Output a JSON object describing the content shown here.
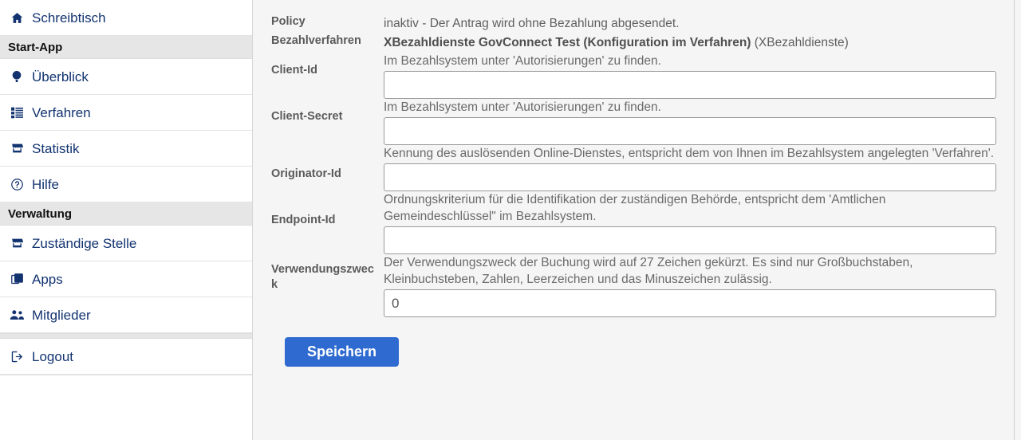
{
  "sidebar": {
    "top_items": [
      {
        "label": "Schreibtisch",
        "icon": "home-icon",
        "name": "schreibtisch"
      }
    ],
    "sections": [
      {
        "title": "Start-App",
        "items": [
          {
            "label": "Überblick",
            "icon": "balloon-icon",
            "name": "ueberblick"
          },
          {
            "label": "Verfahren",
            "icon": "list-icon",
            "name": "verfahren"
          },
          {
            "label": "Statistik",
            "icon": "storefront-icon",
            "name": "statistik"
          },
          {
            "label": "Hilfe",
            "icon": "help-circle-icon",
            "name": "hilfe"
          }
        ]
      },
      {
        "title": "Verwaltung",
        "items": [
          {
            "label": "Zuständige Stelle",
            "icon": "storefront-icon",
            "name": "zustaendige-stelle"
          },
          {
            "label": "Apps",
            "icon": "layers-icon",
            "name": "apps"
          },
          {
            "label": "Mitglieder",
            "icon": "people-icon",
            "name": "mitglieder"
          }
        ]
      }
    ],
    "footer_items": [
      {
        "label": "Logout",
        "icon": "logout-icon",
        "name": "logout"
      }
    ]
  },
  "form": {
    "policy": {
      "label": "Policy",
      "value": "inaktiv - Der Antrag wird ohne Bezahlung abgesendet."
    },
    "bezahlverfahren": {
      "label": "Bezahlverfahren",
      "value_bold": "XBezahldienste GovConnect Test (Konfiguration im Verfahren)",
      "value_suffix": " (XBezahldienste)"
    },
    "fields": [
      {
        "label": "Client-Id",
        "help": "Im Bezahlsystem unter 'Autorisierungen' zu finden.",
        "value": "",
        "name": "client-id"
      },
      {
        "label": "Client-Secret",
        "help": "Im Bezahlsystem unter 'Autorisierungen' zu finden.",
        "value": "",
        "name": "client-secret"
      },
      {
        "label": "Originator-Id",
        "help": "Kennung des auslösenden Online-Dienstes, entspricht dem von Ihnen im Bezahlsystem angelegten 'Verfahren'.",
        "value": "",
        "name": "originator-id"
      },
      {
        "label": "Endpoint-Id",
        "help": "Ordnungskriterium für die Identifikation der zuständigen Behörde, entspricht dem 'Amtlichen Gemeindeschlüssel\" im Bezahlsystem.",
        "value": "",
        "name": "endpoint-id"
      },
      {
        "label": "Verwendungszweck",
        "help": "Der Verwendungszweck der Buchung wird auf 27 Zeichen gekürzt. Es sind nur Großbuchstaben, Kleinbuchsteben, Zahlen, Leerzeichen und das Minuszeichen zulässig.",
        "value": "0",
        "name": "verwendungszweck"
      }
    ],
    "save_label": "Speichern"
  },
  "colors": {
    "nav_text": "#123370",
    "section_bg": "#e6e6e6",
    "content_bg": "#f5f5f5",
    "button_blue": "#2f6ad1",
    "label_gray": "#5a5a5a"
  }
}
